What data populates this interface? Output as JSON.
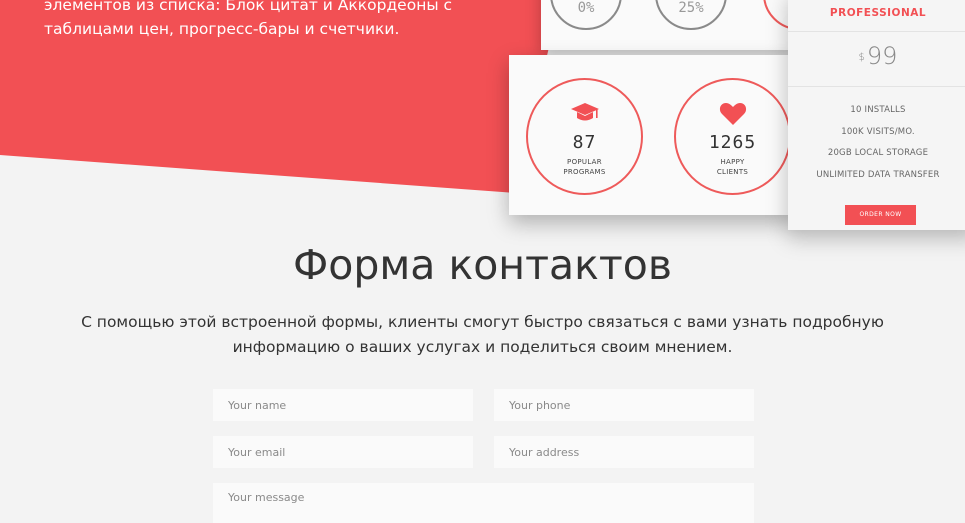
{
  "hero": {
    "text": "элементов из списка: Блок цитат и Аккордеоны с таблицами цен, прогресс-бары и счетчики.",
    "accent_color": "#f25054"
  },
  "top_circles": [
    {
      "value": "0%"
    },
    {
      "value": "25%"
    },
    {
      "value": ""
    }
  ],
  "stats": [
    {
      "icon": "graduation-cap-icon",
      "value": "87",
      "label_line1": "POPULAR",
      "label_line2": "PROGRAMS"
    },
    {
      "icon": "heart-icon",
      "value": "1265",
      "label_line1": "HAPPY",
      "label_line2": "CLIENTS"
    }
  ],
  "pricing": {
    "title": "PROFESSIONAL",
    "currency": "$",
    "amount": "99",
    "features": [
      "10 INSTALLS",
      "100K VISITS/MO.",
      "20GB LOCAL STORAGE",
      "UNLIMITED DATA TRANSFER"
    ],
    "button_label": "ORDER NOW"
  },
  "contact": {
    "title": "Форма контактов",
    "description_line1": "С помощью этой встроенной формы, клиенты смогут быстро связаться с вами узнать подробную",
    "description_line2": "информацию о ваших услугах и поделиться своим мнением.",
    "fields": {
      "name_placeholder": "Your name",
      "phone_placeholder": "Your phone",
      "email_placeholder": "Your email",
      "address_placeholder": "Your address",
      "message_placeholder": "Your message"
    }
  }
}
